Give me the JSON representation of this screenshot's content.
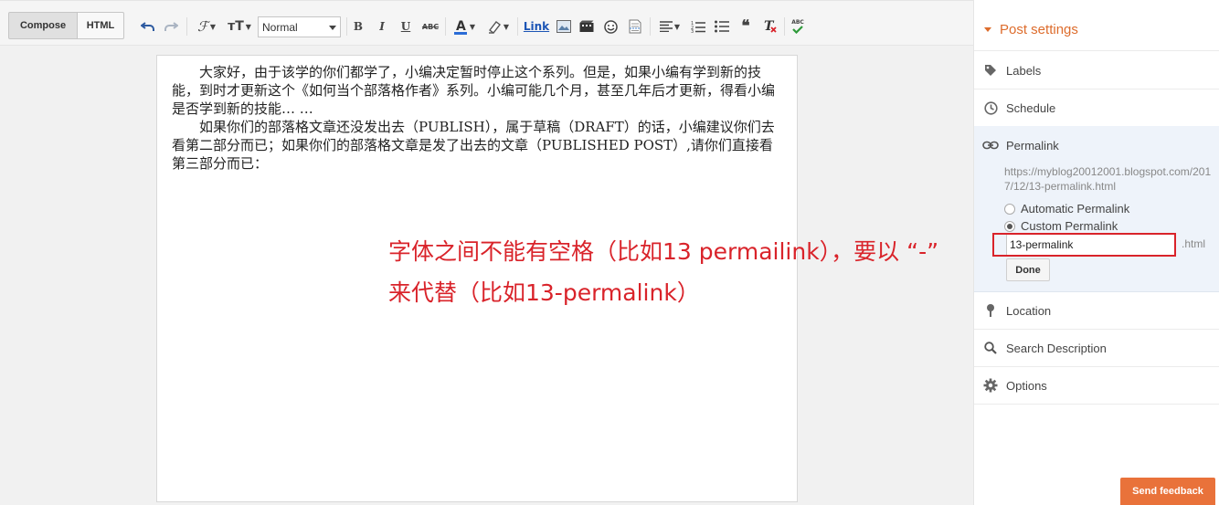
{
  "toolbar": {
    "compose_label": "Compose",
    "html_label": "HTML",
    "format_value": "Normal",
    "bold_label": "B",
    "italic_label": "I",
    "underline_label": "U",
    "strike_label": "ABC",
    "link_label": "Link",
    "spellcheck_label": "ABC"
  },
  "editor": {
    "paragraphs": [
      "大家好，由于该学的你们都学了，小编决定暂时停止这个系列。但是，如果小编有学到新的技能，到时才更新这个《如何当个部落格作者》系列。小编可能几个月，甚至几年后才更新，得看小编是否学到新的技能… …",
      "如果你们的部落格文章还没发出去（PUBLISH），属于草稿（DRAFT）的话，小编建议你们去看第二部分而已；如果你们的部落格文章是发了出去的文章（PUBLISHED POST）,请你们直接看第三部分而已："
    ]
  },
  "annotation": {
    "line1": "字体之间不能有空格（比如13 permailink），要以 “-”",
    "line2": "来代替（比如13-permalink）"
  },
  "sidebar": {
    "header": "Post settings",
    "labels": "Labels",
    "schedule": "Schedule",
    "permalink": "Permalink",
    "permalink_url": "https://myblog20012001.blogspot.com/2017/12/13-permalink.html",
    "automatic_permalink": "Automatic Permalink",
    "custom_permalink": "Custom Permalink",
    "permalink_input_value": "13-permalink",
    "html_suffix": ".html",
    "done": "Done",
    "location": "Location",
    "search_description": "Search Description",
    "options": "Options"
  },
  "feedback": {
    "label": "Send feedback"
  },
  "colors": {
    "accent_orange": "#dd6c2c",
    "annotation_red": "#d9232a",
    "feedback_bg": "#e9723a",
    "permalink_panel_bg": "#eef3fa"
  }
}
